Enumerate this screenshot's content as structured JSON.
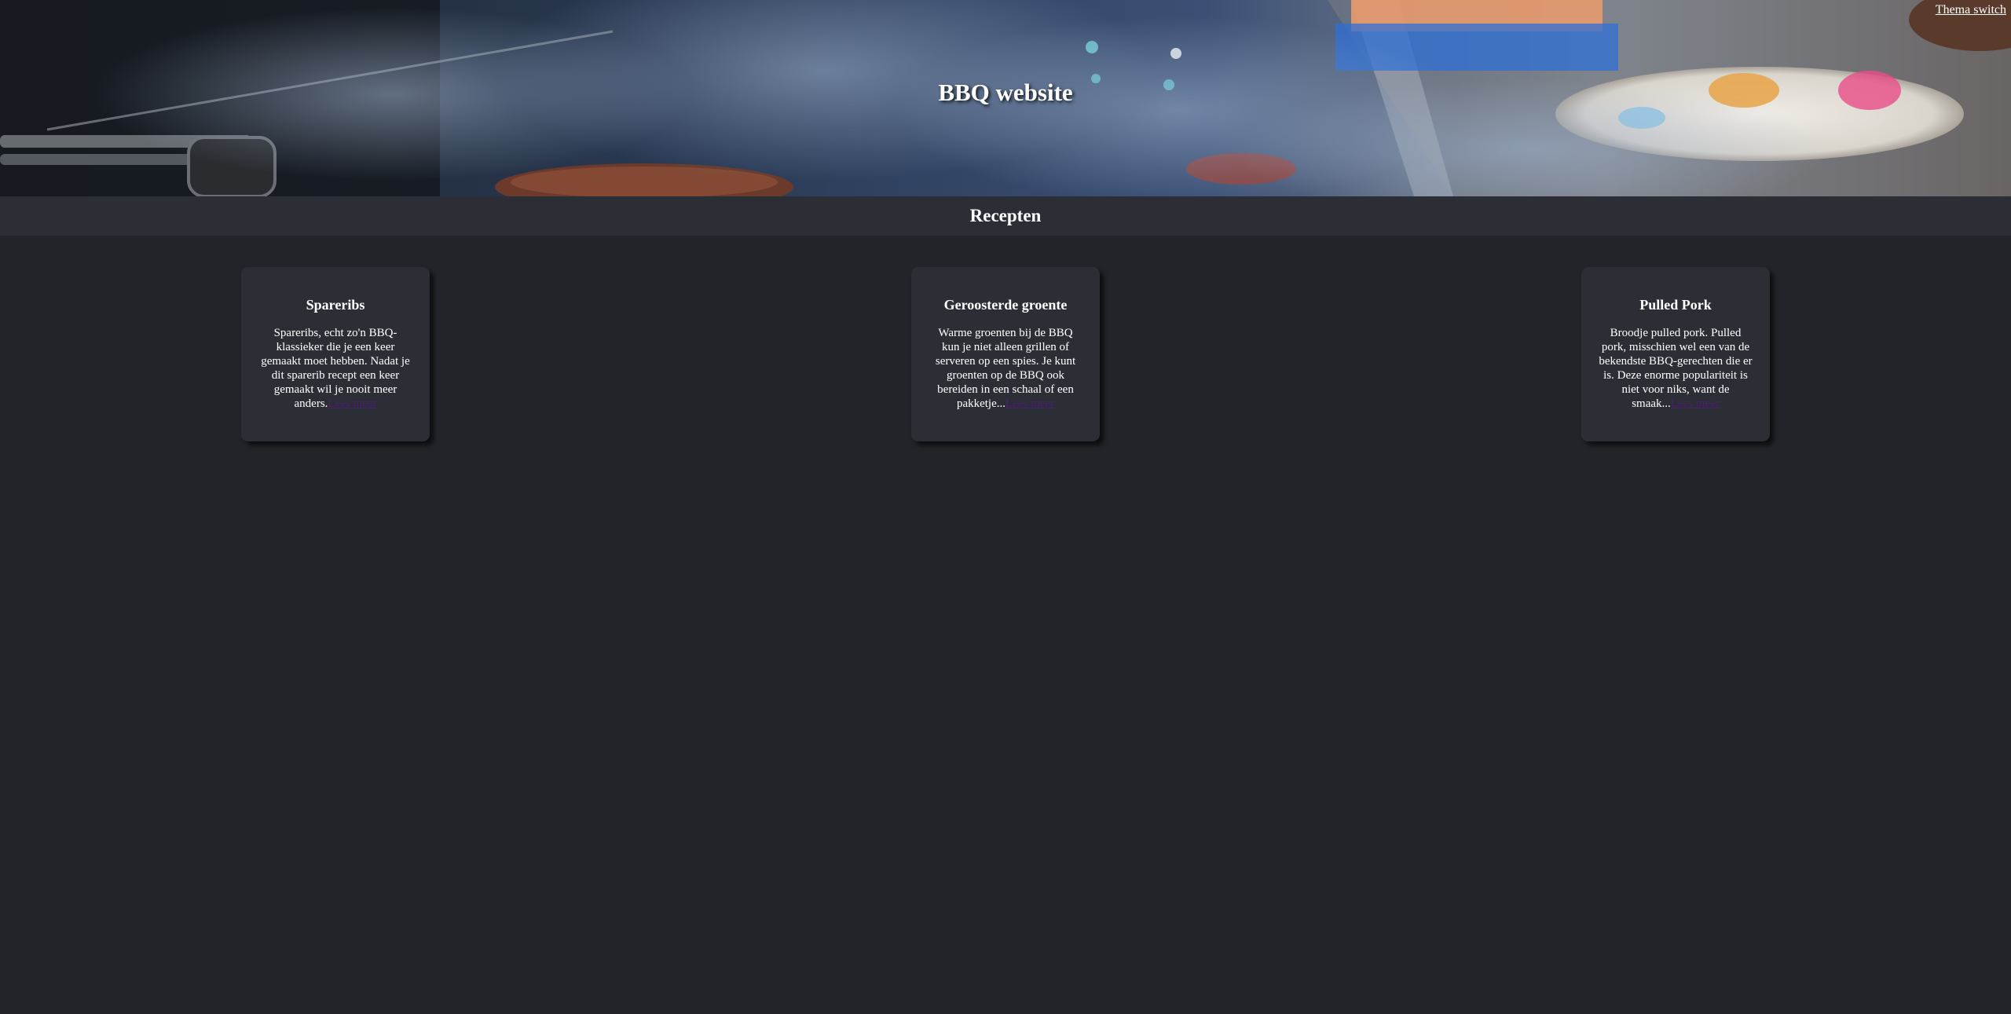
{
  "header": {
    "title": "BBQ website",
    "theme_switch": "Thema switch"
  },
  "section": {
    "title": "Recepten"
  },
  "recipes": [
    {
      "title": "Spareribs",
      "description": "Spareribs, echt zo'n BBQ-klassieker die je een keer gemaakt moet hebben. Nadat je dit sparerib recept een keer gemaakt wil je nooit meer anders.",
      "link": "Lees meer"
    },
    {
      "title": "Geroosterde groente",
      "description": "Warme groenten bij de BBQ kun je niet alleen grillen of serveren op een spies. Je kunt groenten op de BBQ ook bereiden in een schaal of een pakketje...",
      "link": "Lees meer"
    },
    {
      "title": "Pulled Pork",
      "description": "Broodje pulled pork. Pulled pork, misschien wel een van de bekendste BBQ-gerechten die er is. Deze enorme populariteit is niet voor niks, want de smaak...",
      "link": "Lees meer"
    }
  ],
  "colors": {
    "background": "#212529",
    "bar": "#2b2f35",
    "card": "#2b2f35",
    "link": "#4a1f6e"
  }
}
